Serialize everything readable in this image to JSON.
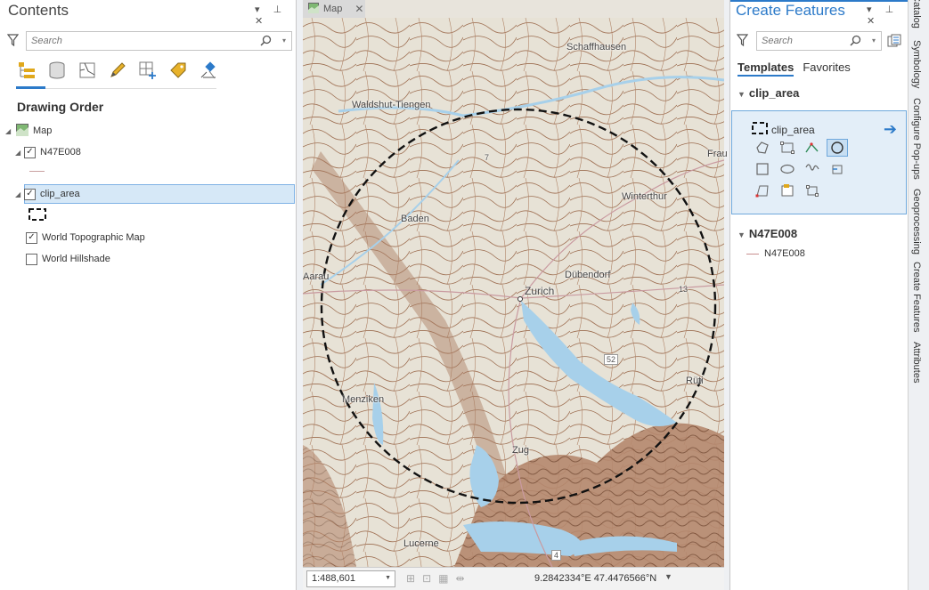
{
  "contents": {
    "title": "Contents",
    "search_placeholder": "Search",
    "heading": "Drawing Order",
    "tree": {
      "map": "Map",
      "layer1": "N47E008",
      "layer2": "clip_area",
      "layer3": "World Topographic Map",
      "layer4": "World Hillshade"
    }
  },
  "map": {
    "tab_label": "Map",
    "labels": {
      "schaffhausen": "Schaffhausen",
      "waldshut": "Waldshut-Tiengen",
      "baden": "Baden",
      "winterthur": "Winterthur",
      "aarau": "Aarau",
      "dubendorf": "Dübendorf",
      "zurich": "Zurich",
      "zug": "Zug",
      "lucerne": "Lucerne",
      "fra": "Frau",
      "menziken": "Menziken",
      "r_label": "Rüti",
      "road_52": "52",
      "road_4": "4",
      "road_13": "13",
      "road_7": "7"
    },
    "scale": "1:488,601",
    "coordinates": "9.2842334°E 47.4476566°N"
  },
  "create_features": {
    "title": "Create Features",
    "search_placeholder": "Search",
    "tabs": [
      "Templates",
      "Favorites"
    ],
    "group1": "clip_area",
    "template_name": "clip_area",
    "group2": "N47E008",
    "group2_item": "N47E008"
  },
  "side_tabs": [
    "Catalog",
    "Symbology",
    "Configure Pop-ups",
    "Geoprocessing",
    "Create Features",
    "Attributes"
  ]
}
